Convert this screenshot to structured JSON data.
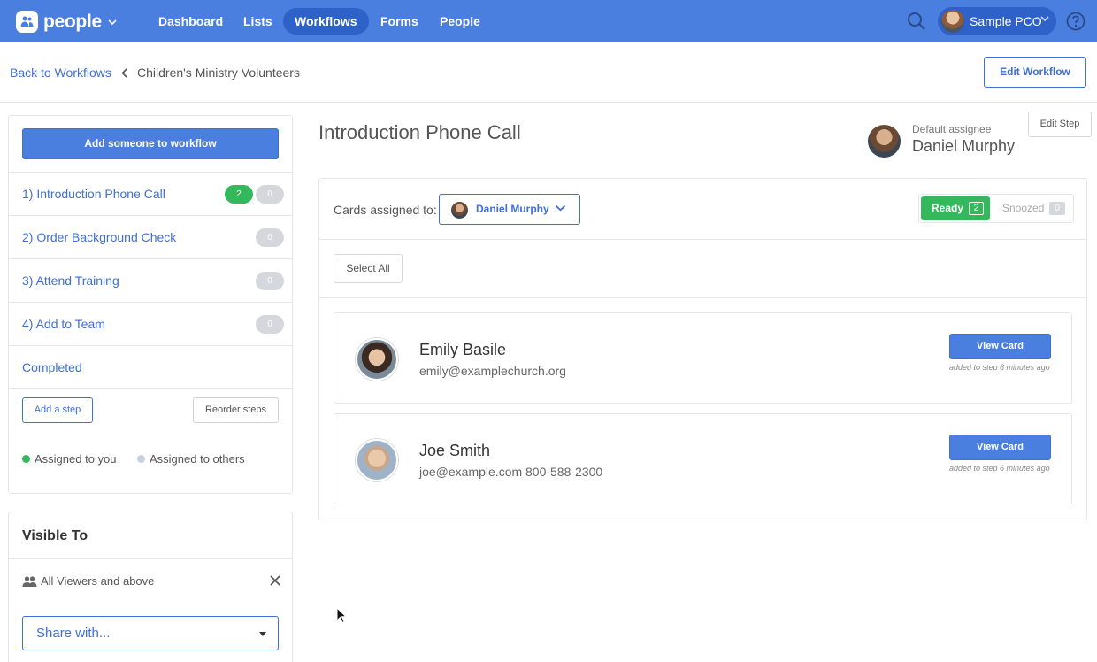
{
  "topnav": {
    "brand": "people",
    "items": [
      "Dashboard",
      "Lists",
      "Workflows",
      "Forms",
      "People"
    ],
    "active": "Workflows",
    "user": "Sample PCO"
  },
  "breadcrumb": {
    "back": "Back to Workflows",
    "current": "Children's Ministry Volunteers",
    "edit_workflow": "Edit Workflow"
  },
  "sidebar": {
    "add_button": "Add someone to workflow",
    "steps": [
      {
        "label": "1) Introduction Phone Call",
        "mine": "2",
        "others": "0"
      },
      {
        "label": "2) Order Background Check",
        "others": "0"
      },
      {
        "label": "3) Attend Training",
        "others": "0"
      },
      {
        "label": "4) Add to Team",
        "others": "0"
      },
      {
        "label": "Completed"
      }
    ],
    "add_step": "Add a step",
    "reorder_steps": "Reorder steps",
    "legend": {
      "mine": "Assigned to you",
      "others": "Assigned to others"
    }
  },
  "visible_to": {
    "title": "Visible To",
    "viewers": "All Viewers and above",
    "share_placeholder": "Share with..."
  },
  "step": {
    "title": "Introduction Phone Call",
    "default_assignee_caption": "Default assignee",
    "default_assignee": "Daniel Murphy",
    "edit_step": "Edit Step"
  },
  "cards_panel": {
    "assigned_label": "Cards assigned to:",
    "assignee": "Daniel Murphy",
    "ready_label": "Ready",
    "ready_count": "2",
    "snoozed_label": "Snoozed",
    "snoozed_count": "0",
    "select_all": "Select All",
    "cards": [
      {
        "name": "Emily Basile",
        "email": "emily@examplechurch.org",
        "phone": "",
        "button": "View Card",
        "added": "added to step 6 minutes ago"
      },
      {
        "name": "Joe Smith",
        "email": "joe@example.com",
        "phone": "800-588-2300",
        "button": "View Card",
        "added": "added to step 6 minutes ago"
      }
    ]
  },
  "colors": {
    "accent": "#4a7fe0",
    "nav_active": "#2e62c9",
    "green": "#33b85c",
    "gray_badge": "#d5d7dc"
  }
}
